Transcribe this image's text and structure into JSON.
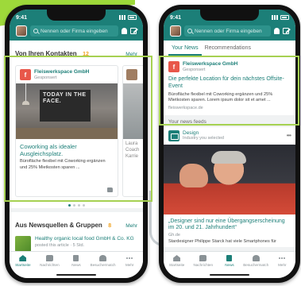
{
  "status": {
    "time": "9:41"
  },
  "search": {
    "placeholder": "Nennen oder Firma eingeben"
  },
  "left": {
    "section1": {
      "title": "Von Ihren Kontakten",
      "count": "12",
      "more": "Mehr"
    },
    "card": {
      "org_name": "Fleiswerkspace GmbH",
      "org_sub": "Gesponsert",
      "poster_text": "TODAY IN THE FACE.",
      "title": "Coworking als idealer Ausgleichsplatz.",
      "text": "Bürofläche flexibel mit Coworking ergänzen und 25% Mietkosten sparen ..."
    },
    "next_card": {
      "text": "Laura Coach Karrie"
    },
    "section2": {
      "title": "Aus Newsquellen & Gruppen",
      "count": "8",
      "more": "Mehr"
    },
    "news_item": {
      "title": "Healthy organic local food GmbH & Co. KG",
      "sub": "posted this article · 5 Std."
    }
  },
  "right": {
    "tabs": [
      "Your News",
      "Recommendations"
    ],
    "ad": {
      "org_name": "Fleiswerkspace GmbH",
      "org_sub": "Gesponsert",
      "title": "Die perfekte Location für dein nächstes Offsite-Event",
      "text": "Bürofläche flexibel mit Coworking ergänzen und 25% Mietkosten sparen. Lorem ipsum dolor sit et amet ...",
      "source": "fleiswerkspace.de"
    },
    "feeds_label": "Your news feeds",
    "feed": {
      "name": "Design",
      "sub": "Industry you selected",
      "more": "•••",
      "title": "„Designer sind nur eine Übergangserscheinung im 20. und 21. Jahrhundert“",
      "date": "Gh.de",
      "text": "Stardesigner Philippe Starck hat viele Smartphones für"
    }
  },
  "tabbar": {
    "items": [
      {
        "label": "Startseite"
      },
      {
        "label": "Nachrichten"
      },
      {
        "label": "News"
      },
      {
        "label": "Besuchermatch"
      },
      {
        "label": "Mehr"
      }
    ]
  },
  "colors": {
    "brand": "#1c7f78",
    "highlight": "#a6d152",
    "accent": "#9ed93a",
    "badge": "#f0a11c"
  }
}
